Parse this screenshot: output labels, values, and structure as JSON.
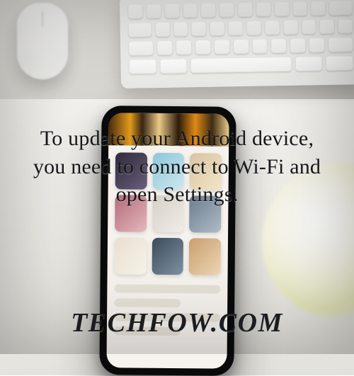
{
  "caption": "To update your Android device, you need to connect to Wi-Fi and open Settings.",
  "watermark": "TECHFOW.COM"
}
